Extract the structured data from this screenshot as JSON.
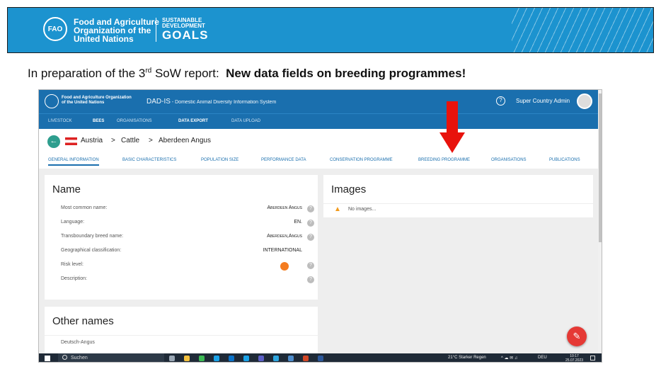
{
  "banner": {
    "fao_name": "Food and Agriculture\nOrganization of the\nUnited Nations",
    "sdg_line1": "SUSTAINABLE",
    "sdg_line2": "DEVELOPMENT",
    "sdg_line3": "GOALS"
  },
  "headline": {
    "prefix": "In preparation of the 3",
    "sup": "rd",
    "middle": " SoW report:  ",
    "bold": "New data fields on breeding programmes!"
  },
  "app": {
    "org": "Food and Agriculture Organization\nof the United Nations",
    "title": "DAD-IS",
    "subtitle": " - Domestic Animal Diversity Information System",
    "user": "Super Country Admin",
    "help": "?"
  },
  "nav": [
    "LIVESTOCK",
    "BEES",
    "ORGANISATIONS",
    "DATA EXPORT",
    "DATA UPLOAD"
  ],
  "breadcrumb": {
    "country": "Austria",
    "sep": ">",
    "species": "Cattle",
    "breed": "Aberdeen Angus"
  },
  "tabs": [
    "GENERAL INFORMATION",
    "BASIC CHARACTERISTICS",
    "POPULATION SIZE",
    "PERFORMANCE DATA",
    "CONSERVATION PROGRAMME",
    "BREEDING PROGRAMME",
    "ORGANISATIONS",
    "PUBLICATIONS"
  ],
  "name_card": {
    "title": "Name",
    "rows": [
      {
        "label": "Most common name:",
        "value": "Aberdeen Angus"
      },
      {
        "label": "Language:",
        "value": "EN."
      },
      {
        "label": "Transboundary breed name:",
        "value": "Aberdeen,Angus"
      },
      {
        "label": "Geographical classification:",
        "value": "INTERNATIONAL"
      },
      {
        "label": "Risk level:",
        "value": ""
      },
      {
        "label": "Description:",
        "value": ""
      }
    ]
  },
  "images_card": {
    "title": "Images",
    "empty": "No images..."
  },
  "other_names": {
    "title": "Other names",
    "item": "Deutsch-Angus"
  },
  "taskbar": {
    "search": "Suchen",
    "weather": "21°C  Starker Regen",
    "lang": "DEU",
    "time": "10:17",
    "date": "25.07.2023"
  },
  "colors": {
    "banner": "#1c93cf",
    "app_bar": "#1a6fae",
    "arrow": "#e8120c",
    "risk": "#f47c20",
    "fab": "#e53935"
  }
}
